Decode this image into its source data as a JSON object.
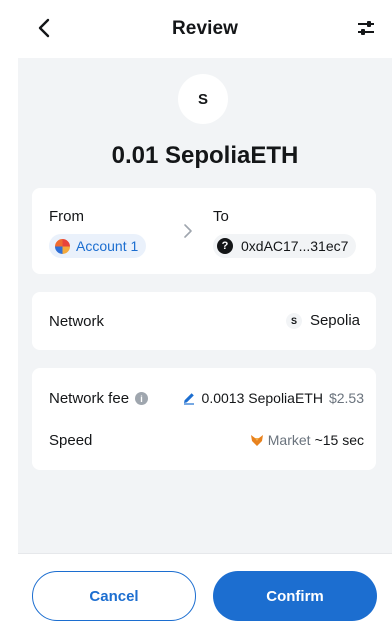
{
  "header": {
    "title": "Review"
  },
  "token": {
    "symbol": "S",
    "amount": "0.01 SepoliaETH"
  },
  "transfer": {
    "from_label": "From",
    "from_account": "Account 1",
    "to_label": "To",
    "to_address": "0xdAC17...31ec7"
  },
  "network": {
    "label": "Network",
    "icon_letter": "S",
    "value": "Sepolia"
  },
  "fee": {
    "label": "Network fee",
    "amount": "0.0013 SepoliaETH",
    "fiat": "$2.53",
    "speed_label": "Speed",
    "speed_name": "Market",
    "speed_time": "~15 sec"
  },
  "footer": {
    "cancel_label": "Cancel",
    "confirm_label": "Confirm"
  },
  "colors": {
    "accent": "#1c6ed0",
    "background": "#f2f4f6",
    "text": "#141618",
    "muted": "#6a737d"
  },
  "icons": {
    "back": "chevron-left-icon",
    "settings": "sliders-icon",
    "arrow": "chevron-right-icon",
    "info": "info-icon",
    "edit": "pencil-icon",
    "speed": "fox-icon"
  }
}
